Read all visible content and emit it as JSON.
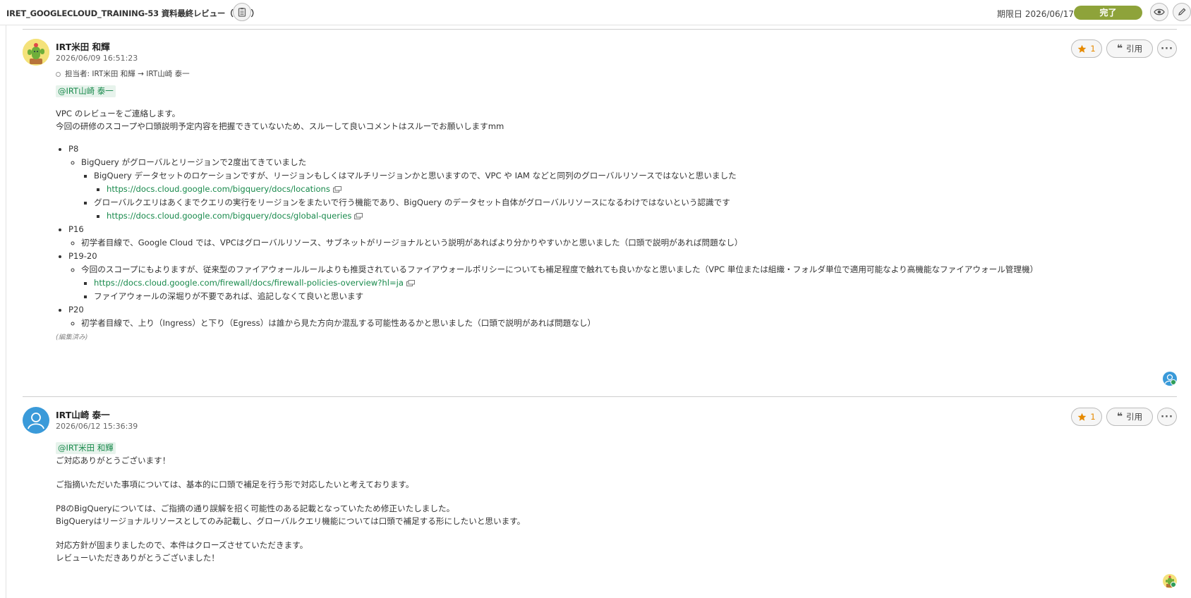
{
  "header": {
    "title": "IRET_GOOGLECLOUD_TRAINING-53  資料最終レビュー（VPC）",
    "due_label": "期限日 2026/06/17",
    "status_button": "完了"
  },
  "comments": [
    {
      "author": "IRT米田 和輝",
      "date": "2026/06/09 16:51:23",
      "star_count": "1",
      "quote_label": "引用",
      "assignment": "担当者: IRT米田 和輝 → IRT山崎 泰一",
      "mention": "@IRT山崎 泰一",
      "intro": [
        "VPC のレビューをご連絡します。",
        "今回の研修のスコープや口頭説明予定内容を把握できていないため、スルーして良いコメントはスルーでお願いしますmm"
      ],
      "items": [
        {
          "label": "P8",
          "sub": [
            {
              "text": "BigQuery がグローバルとリージョンで2度出てきていました",
              "sub": [
                {
                  "text": "BigQuery データセットのロケーションですが、リージョンもしくはマルチリージョンかと思いますので、VPC や IAM などと同列のグローバルリソースではないと思いました",
                  "link": "https://docs.cloud.google.com/bigquery/docs/locations"
                },
                {
                  "text": "グローバルクエリはあくまでクエリの実行をリージョンをまたいで行う機能であり、BigQuery のデータセット自体がグローバルリソースになるわけではないという認識です",
                  "link": "https://docs.cloud.google.com/bigquery/docs/global-queries"
                }
              ]
            }
          ]
        },
        {
          "label": "P16",
          "sub": [
            {
              "text": "初学者目線で、Google Cloud では、VPCはグローバルリソース、サブネットがリージョナルという説明があればより分かりやすいかと思いました（口頭で説明があれば問題なし）"
            }
          ]
        },
        {
          "label": "P19-20",
          "sub": [
            {
              "text": "今回のスコープにもよりますが、従来型のファイアウォールルールよりも推奨されているファイアウォールポリシーについても補足程度で触れても良いかなと思いました（VPC 単位または組織・フォルダ単位で適用可能なより高機能なファイアウォール管理機）",
              "link": "https://docs.cloud.google.com/firewall/docs/firewall-policies-overview?hl=ja",
              "note": "ファイアウォールの深堀りが不要であれば、追記しなくて良いと思います"
            }
          ]
        },
        {
          "label": "P20",
          "sub": [
            {
              "text": "初学者目線で、上り（Ingress）と下り（Egress）は誰から見た方向か混乱する可能性あるかと思いました（口頭で説明があれば問題なし）"
            }
          ]
        }
      ],
      "edited": "(編集済み)"
    },
    {
      "author": "IRT山崎 泰一",
      "date": "2026/06/12 15:36:39",
      "star_count": "1",
      "quote_label": "引用",
      "mention": "@IRT米田 和輝",
      "lines": [
        "ご対応ありがとうございます！",
        "",
        "ご指摘いただいた事項については、基本的に口頭で補足を行う形で対応したいと考えております。",
        "",
        "P8のBigQueryについては、ご指摘の通り誤解を招く可能性のある記載となっていたため修正いたしました。",
        "BigQueryはリージョナルリソースとしてのみ記載し、グローバルクエリ機能については口頭で補足する形にしたいと思います。",
        "",
        "対応方針が固まりましたので、本件はクローズさせていただきます。",
        "レビューいただきありがとうございました！"
      ]
    }
  ],
  "colors": {
    "accent_green": "#198a4c",
    "done_button": "#8ea33a",
    "star": "#e68a00",
    "avatar_blue": "#3a9ad9"
  }
}
